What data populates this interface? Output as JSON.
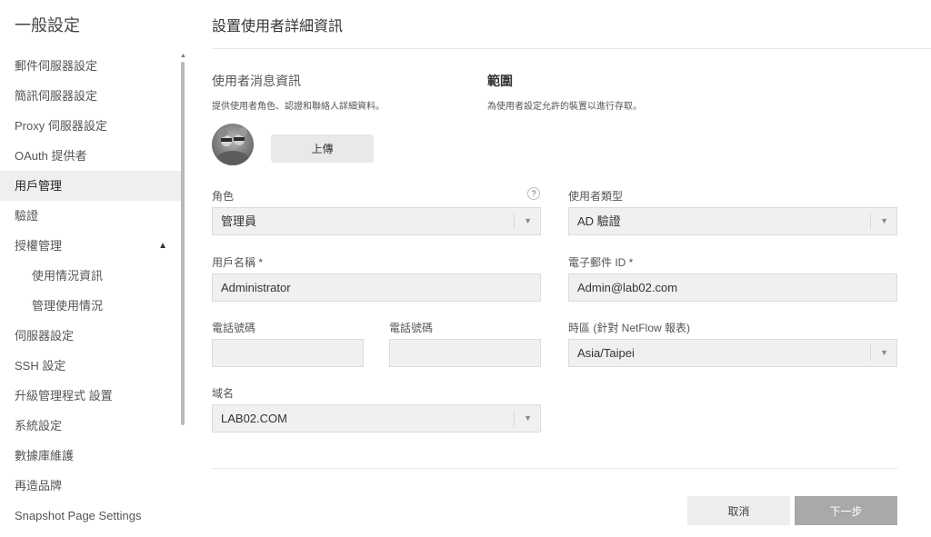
{
  "sidebar": {
    "title": "一般設定",
    "items": [
      {
        "label": "郵件伺服器設定"
      },
      {
        "label": "簡訊伺服器設定"
      },
      {
        "label": "Proxy 伺服器設定"
      },
      {
        "label": "OAuth 提供者"
      },
      {
        "label": "用戶管理"
      },
      {
        "label": "驗證"
      },
      {
        "label": "授權管理"
      },
      {
        "label": "使用情況資訊"
      },
      {
        "label": "管理使用情況"
      },
      {
        "label": "伺服器設定"
      },
      {
        "label": "SSH 設定"
      },
      {
        "label": "升級管理程式 設置"
      },
      {
        "label": "系統設定"
      },
      {
        "label": "數據庫維護"
      },
      {
        "label": "再造品牌"
      },
      {
        "label": "Snapshot Page Settings"
      }
    ]
  },
  "main": {
    "page_title": "設置使用者詳細資訊",
    "user_info": {
      "title": "使用者消息資訊",
      "desc": "提供使用者角色、認證和聯絡人詳細資料。"
    },
    "scope": {
      "title": "範圍",
      "desc": "為使用者設定允許的裝置以進行存取。"
    },
    "upload_label": "上傳",
    "form": {
      "role": {
        "label": "角色",
        "value": "管理員",
        "help": "?"
      },
      "user_type": {
        "label": "使用者類型",
        "value": "AD 驗證"
      },
      "username": {
        "label": "用戶名稱 *",
        "value": "Administrator"
      },
      "email": {
        "label": "電子郵件 ID *",
        "value": "Admin@lab02.com"
      },
      "phone1": {
        "label": "電話號碼",
        "value": ""
      },
      "phone2": {
        "label": "電話號碼",
        "value": ""
      },
      "timezone": {
        "label": "時區 (針對 NetFlow 報表)",
        "value": "Asia/Taipei"
      },
      "domain": {
        "label": "域名",
        "value": "LAB02.COM"
      }
    },
    "buttons": {
      "cancel": "取消",
      "next": "下一步"
    }
  },
  "icons": {
    "caret_down": "▼",
    "caret_up": "▲"
  }
}
